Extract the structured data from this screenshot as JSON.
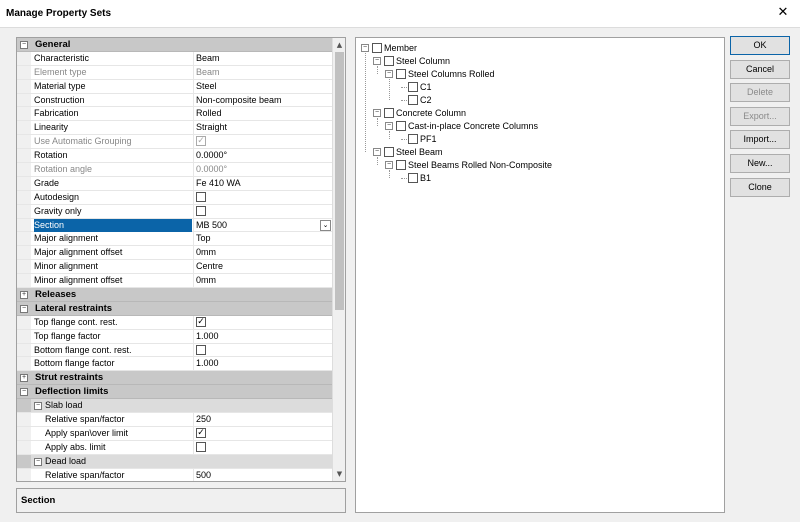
{
  "window": {
    "title": "Manage Property Sets",
    "close_glyph": "✕"
  },
  "grid": {
    "rows": [
      {
        "type": "cat",
        "label": "General",
        "glyph": "−"
      },
      {
        "label": "Characteristic",
        "value": "Beam"
      },
      {
        "label": "Element type",
        "value": "Beam",
        "disabled": true
      },
      {
        "label": "Material type",
        "value": "Steel"
      },
      {
        "label": "Construction",
        "value": "Non-composite beam"
      },
      {
        "label": "Fabrication",
        "value": "Rolled"
      },
      {
        "label": "Linearity",
        "value": "Straight"
      },
      {
        "label": "Use Automatic Grouping",
        "check": true,
        "disabled": true
      },
      {
        "label": "Rotation",
        "value": "0.0000°"
      },
      {
        "label": "Rotation angle",
        "value": "0.0000°",
        "disabled": true
      },
      {
        "label": "Grade",
        "value": "Fe 410 WA"
      },
      {
        "label": "Autodesign",
        "check": false
      },
      {
        "label": "Gravity only",
        "check": false
      },
      {
        "label": "Section",
        "value": "MB 500",
        "selected": true,
        "dropdown": true
      },
      {
        "label": "Major alignment",
        "value": "Top"
      },
      {
        "label": "Major alignment offset",
        "value": "0mm"
      },
      {
        "label": "Minor alignment",
        "value": "Centre"
      },
      {
        "label": "Minor alignment offset",
        "value": "0mm"
      },
      {
        "type": "cat",
        "label": "Releases",
        "glyph": "+"
      },
      {
        "type": "cat",
        "label": "Lateral restraints",
        "glyph": "−"
      },
      {
        "label": "Top flange cont. rest.",
        "check": true
      },
      {
        "label": "Top flange factor",
        "value": "1.000"
      },
      {
        "label": "Bottom flange cont. rest.",
        "check": false
      },
      {
        "label": "Bottom flange factor",
        "value": "1.000"
      },
      {
        "type": "cat",
        "label": "Strut restraints",
        "glyph": "+"
      },
      {
        "type": "cat",
        "label": "Deflection limits",
        "glyph": "−"
      },
      {
        "type": "subcat",
        "label": "Slab load",
        "glyph": "−"
      },
      {
        "label": "Relative span/factor",
        "value": "250",
        "indent": true
      },
      {
        "label": "Apply span\\over limit",
        "check": true,
        "indent": true
      },
      {
        "label": "Apply abs. limit",
        "check": false,
        "indent": true
      },
      {
        "type": "subcat",
        "label": "Dead load",
        "glyph": "−"
      },
      {
        "label": "Relative span/factor",
        "value": "500",
        "indent": true
      }
    ]
  },
  "description": {
    "text": "Section"
  },
  "tree": {
    "nodes": [
      {
        "label": "Member",
        "level": 0,
        "expanded": true
      },
      {
        "label": "Steel Column",
        "level": 1,
        "expanded": true
      },
      {
        "label": "Steel Columns Rolled",
        "level": 2,
        "expanded": true
      },
      {
        "label": "C1",
        "level": 3
      },
      {
        "label": "C2",
        "level": 3
      },
      {
        "label": "Concrete Column",
        "level": 1,
        "expanded": true
      },
      {
        "label": "Cast-in-place Concrete Columns",
        "level": 2,
        "expanded": true
      },
      {
        "label": "PF1",
        "level": 3
      },
      {
        "label": "Steel Beam",
        "level": 1,
        "expanded": true
      },
      {
        "label": "Steel Beams Rolled Non-Composite",
        "level": 2,
        "expanded": true
      },
      {
        "label": "B1",
        "level": 3
      }
    ]
  },
  "buttons": [
    {
      "label": "OK",
      "disabled": false,
      "primary": true
    },
    {
      "label": "Cancel",
      "disabled": false
    },
    {
      "label": "Delete",
      "disabled": true
    },
    {
      "label": "Export...",
      "disabled": true
    },
    {
      "label": "Import...",
      "disabled": false
    },
    {
      "label": "New...",
      "disabled": false
    },
    {
      "label": "Clone",
      "disabled": false
    }
  ],
  "glyphs": {
    "check": "✓",
    "dropdown": "⌄",
    "scroll_up": "▲",
    "scroll_down": "▼",
    "tree_expanded": "−"
  }
}
